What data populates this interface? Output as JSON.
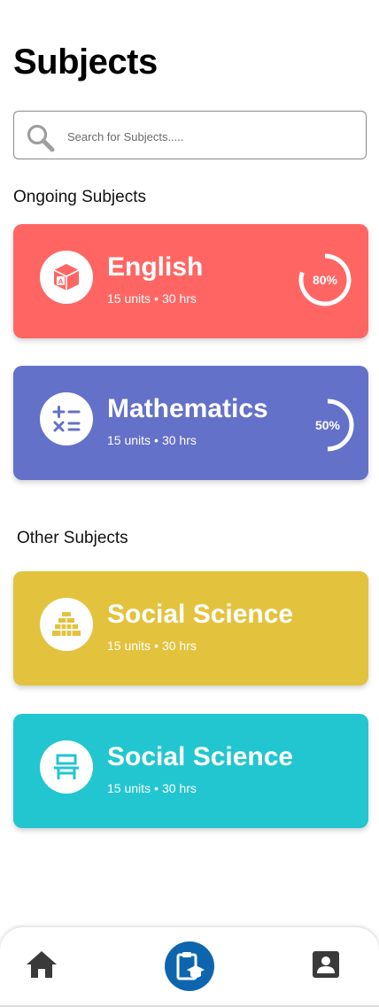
{
  "page": {
    "title": "Subjects"
  },
  "search": {
    "placeholder": "Search for Subjects....."
  },
  "sections": {
    "ongoing": "Ongoing Subjects",
    "other": "Other Subjects"
  },
  "ongoing": [
    {
      "name": "English",
      "units": "15 units",
      "hours": "30 hrs",
      "progress_label": "80%",
      "progress": 0.8,
      "color": "#ff6663",
      "icon": "alphabet-block-icon"
    },
    {
      "name": "Mathematics",
      "units": "15 units",
      "hours": "30 hrs",
      "progress_label": "50%",
      "progress": 0.5,
      "color": "#6471c9",
      "icon": "math-operators-icon"
    }
  ],
  "other": [
    {
      "name": "Social Science",
      "units": "15 units",
      "hours": "30 hrs",
      "color": "#e3c33e",
      "icon": "pyramid-icon"
    },
    {
      "name": "Social Science",
      "units": "15 units",
      "hours": "30 hrs",
      "color": "#22c6d0",
      "icon": "desk-icon"
    }
  ],
  "nav": {
    "items": [
      "home-icon",
      "subjects-clipboard-icon",
      "profile-icon"
    ],
    "active": "subjects-clipboard-icon",
    "active_color": "#0d66ad"
  }
}
